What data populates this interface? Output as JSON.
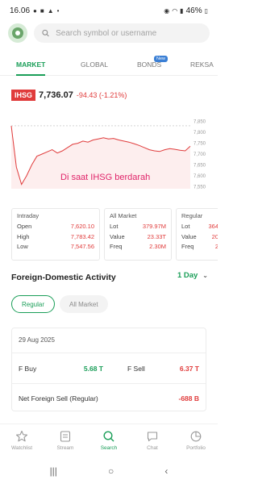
{
  "status_bar": {
    "time": "16.06",
    "battery": "46%"
  },
  "search": {
    "placeholder": "Search symbol or username"
  },
  "tabs": [
    {
      "label": "MARKET",
      "active": true
    },
    {
      "label": "GLOBAL",
      "active": false
    },
    {
      "label": "BONDS",
      "active": false,
      "badge": "New"
    },
    {
      "label": "REKSA",
      "active": false
    }
  ],
  "index": {
    "symbol": "IHSG",
    "value": "7,736.07",
    "change": "-94.43 (-1.21%)"
  },
  "chart_data": {
    "type": "line",
    "yticks": [
      "7,850",
      "7,800",
      "7,750",
      "7,700",
      "7,650",
      "7,600",
      "7,550"
    ],
    "ylim": [
      7540,
      7860
    ],
    "previous_close": 7830.5,
    "values": [
      7830,
      7640,
      7560,
      7600,
      7650,
      7690,
      7700,
      7710,
      7720,
      7705,
      7715,
      7730,
      7745,
      7750,
      7760,
      7755,
      7765,
      7770,
      7775,
      7770,
      7772,
      7765,
      7760,
      7755,
      7748,
      7740,
      7730,
      7720,
      7715,
      7712,
      7720,
      7725,
      7722,
      7718,
      7715,
      7736
    ],
    "line_color": "#e03b3b",
    "annotation": "Di saat IHSG berdarah"
  },
  "stats": {
    "intraday": {
      "title": "Intraday",
      "rows": [
        {
          "label": "Open",
          "value": "7,620.10"
        },
        {
          "label": "High",
          "value": "7,783.42"
        },
        {
          "label": "Low",
          "value": "7,547.56"
        }
      ]
    },
    "all_market": {
      "title": "All Market",
      "rows": [
        {
          "label": "Lot",
          "value": "379.97M"
        },
        {
          "label": "Value",
          "value": "23.33T"
        },
        {
          "label": "Freq",
          "value": "2.30M"
        }
      ]
    },
    "regular": {
      "title": "Regular",
      "rows": [
        {
          "label": "Lot",
          "value": "364"
        },
        {
          "label": "Value",
          "value": "20"
        },
        {
          "label": "Freq",
          "value": "2"
        }
      ]
    }
  },
  "foreign_domestic": {
    "title": "Foreign-Domestic Activity",
    "period": "1 Day",
    "filters": [
      "Regular",
      "All Market"
    ],
    "date": "29 Aug 2025",
    "fbuy_label": "F Buy",
    "fbuy_value": "5.68 T",
    "fsell_label": "F Sell",
    "fsell_value": "6.37 T",
    "net_label": "Net Foreign Sell (Regular)",
    "net_value": "-688 B"
  },
  "bottom_nav": [
    {
      "label": "Watchlist",
      "icon": "star-icon",
      "active": false
    },
    {
      "label": "Stream",
      "icon": "stream-icon",
      "active": false
    },
    {
      "label": "Search",
      "icon": "search-icon",
      "active": true
    },
    {
      "label": "Chat",
      "icon": "chat-icon",
      "active": false
    },
    {
      "label": "Portfolio",
      "icon": "portfolio-icon",
      "active": false
    }
  ],
  "colors": {
    "accent": "#1a9e58",
    "down": "#e03b3b",
    "annotation": "#e0256a"
  }
}
